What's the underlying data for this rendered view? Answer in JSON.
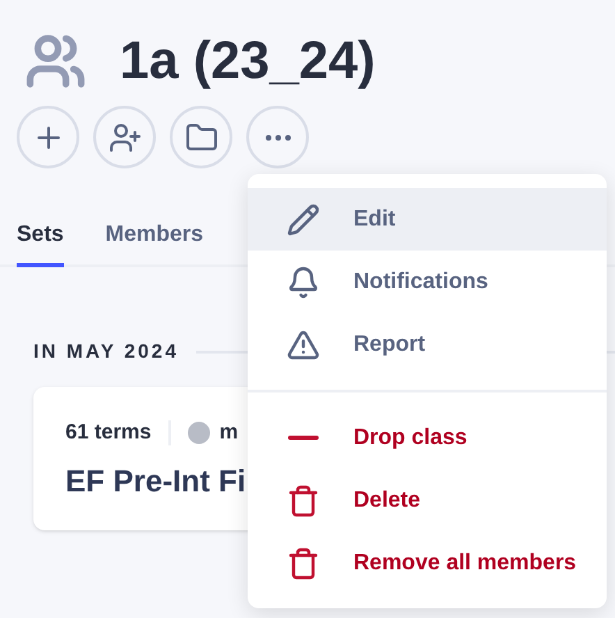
{
  "header": {
    "title": "1a (23_24)"
  },
  "tabs": [
    {
      "label": "Sets",
      "selected": true
    },
    {
      "label": "Members",
      "selected": false
    }
  ],
  "section": {
    "heading": "IN MAY 2024"
  },
  "card": {
    "terms": "61 terms",
    "author": "m",
    "title": "EF Pre-Int Fi"
  },
  "menu": {
    "groups": [
      [
        {
          "label": "Edit",
          "kind": "normal",
          "highlighted": true
        },
        {
          "label": "Notifications",
          "kind": "normal",
          "highlighted": false
        },
        {
          "label": "Report",
          "kind": "normal",
          "highlighted": false
        }
      ],
      [
        {
          "label": "Drop class",
          "kind": "danger",
          "highlighted": false
        },
        {
          "label": "Delete",
          "kind": "danger",
          "highlighted": false
        },
        {
          "label": "Remove all members",
          "kind": "danger",
          "highlighted": false
        }
      ]
    ]
  }
}
